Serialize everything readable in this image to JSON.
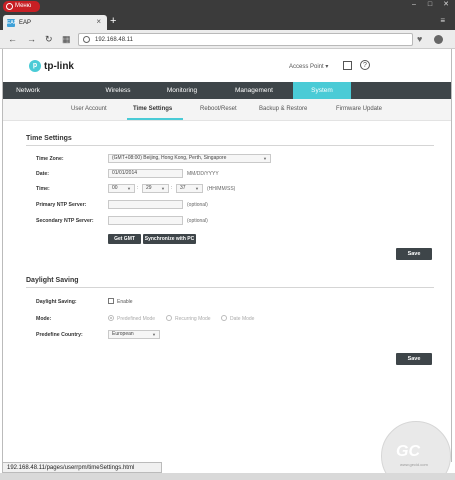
{
  "browser": {
    "menu_label": "Меню",
    "tab_title": "EAP",
    "tab_favicon": "EAP",
    "url": "192.168.48.11",
    "status_url": "192.168.48.11/pages/userrpm/timeSettings.html"
  },
  "header": {
    "logo_text": "tp-link",
    "mode_label": "Access Point",
    "help_symbol": "?"
  },
  "main_nav": [
    {
      "label": "Network"
    },
    {
      "label": "Wireless"
    },
    {
      "label": "Monitoring"
    },
    {
      "label": "Management"
    },
    {
      "label": "System"
    }
  ],
  "active_main_nav": "System",
  "sub_nav": [
    {
      "label": "User Account"
    },
    {
      "label": "Time Settings"
    },
    {
      "label": "Reboot/Reset"
    },
    {
      "label": "Backup & Restore"
    },
    {
      "label": "Firmware Update"
    }
  ],
  "active_sub_nav": "Time Settings",
  "time_settings": {
    "title": "Time Settings",
    "time_zone_label": "Time Zone:",
    "time_zone_value": "(GMT+08:00) Beijing, Hong Kong, Perth, Singapore",
    "date_label": "Date:",
    "date_value": "01/01/2014",
    "date_hint": "MM/DD/YYYY",
    "time_label": "Time:",
    "time_hours": "00",
    "time_minutes": "29",
    "time_seconds": "37",
    "time_sep": ":",
    "time_hint": "(HH/MM/SS)",
    "primary_ntp_label": "Primary NTP Server:",
    "primary_ntp_value": "",
    "primary_ntp_hint": "(optional)",
    "secondary_ntp_label": "Secondary NTP Server:",
    "secondary_ntp_value": "",
    "secondary_ntp_hint": "(optional)",
    "get_gmt_label": "Get GMT",
    "sync_pc_label": "Synchronize with PC",
    "save_label": "Save"
  },
  "daylight_saving": {
    "title": "Daylight Saving",
    "ds_label": "Daylight Saving:",
    "enable_label": "Enable",
    "enabled": false,
    "mode_label": "Mode:",
    "mode_options": [
      "Predefined Mode",
      "Recurring Mode",
      "Date Mode"
    ],
    "selected_mode": "Predefined Mode",
    "country_label": "Predefine Country:",
    "country_value": "European",
    "save_label": "Save"
  },
  "watermark": {
    "text": "GC",
    "sub": "www.gecid.com"
  },
  "colors": {
    "accent": "#4acbd6",
    "nav_dark": "#3e4549",
    "browser_red": "#c81f24"
  }
}
